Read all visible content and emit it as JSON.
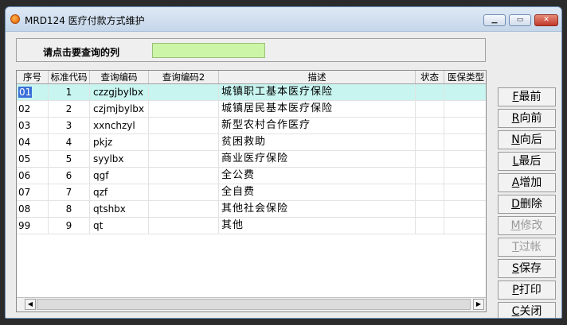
{
  "window": {
    "title": "MRD124 医疗付款方式维护"
  },
  "query": {
    "label": "请点击要查询的列",
    "value": ""
  },
  "table": {
    "columns": [
      "序号",
      "标准代码",
      "查询编码",
      "查询编码2",
      "描述",
      "状态",
      "医保类型"
    ],
    "rows": [
      {
        "seq": "01",
        "code": "1",
        "q1": "czzgjbylbx",
        "q2": "",
        "desc": "城镇职工基本医疗保险",
        "status": "",
        "ins": ""
      },
      {
        "seq": "02",
        "code": "2",
        "q1": "czjmjbylbx",
        "q2": "",
        "desc": "城镇居民基本医疗保险",
        "status": "",
        "ins": ""
      },
      {
        "seq": "03",
        "code": "3",
        "q1": "xxnchzyl",
        "q2": "",
        "desc": "新型农村合作医疗",
        "status": "",
        "ins": ""
      },
      {
        "seq": "04",
        "code": "4",
        "q1": "pkjz",
        "q2": "",
        "desc": "贫困救助",
        "status": "",
        "ins": ""
      },
      {
        "seq": "05",
        "code": "5",
        "q1": "syylbx",
        "q2": "",
        "desc": "商业医疗保险",
        "status": "",
        "ins": ""
      },
      {
        "seq": "06",
        "code": "6",
        "q1": "qgf",
        "q2": "",
        "desc": "全公费",
        "status": "",
        "ins": ""
      },
      {
        "seq": "07",
        "code": "7",
        "q1": "qzf",
        "q2": "",
        "desc": "全自费",
        "status": "",
        "ins": ""
      },
      {
        "seq": "08",
        "code": "8",
        "q1": "qtshbx",
        "q2": "",
        "desc": "其他社会保险",
        "status": "",
        "ins": ""
      },
      {
        "seq": "99",
        "code": "9",
        "q1": "qt",
        "q2": "",
        "desc": "其他",
        "status": "",
        "ins": ""
      }
    ]
  },
  "buttons": {
    "first": {
      "key": "F",
      "label": "最前"
    },
    "prev": {
      "key": "R",
      "label": "向前"
    },
    "next": {
      "key": "N",
      "label": "向后"
    },
    "last": {
      "key": "L",
      "label": "最后"
    },
    "add": {
      "key": "A",
      "label": "增加"
    },
    "delete": {
      "key": "D",
      "label": "删除"
    },
    "modify": {
      "key": "M",
      "label": "修改"
    },
    "post": {
      "key": "T",
      "label": "过帐"
    },
    "save": {
      "key": "S",
      "label": "保存"
    },
    "print": {
      "key": "P",
      "label": "打印"
    },
    "close": {
      "key": "C",
      "label": "关闭"
    }
  },
  "colors": {
    "selected_row": "#c8f5f0",
    "query_input": "#ccf5a7",
    "close_button": "#c0392b"
  }
}
